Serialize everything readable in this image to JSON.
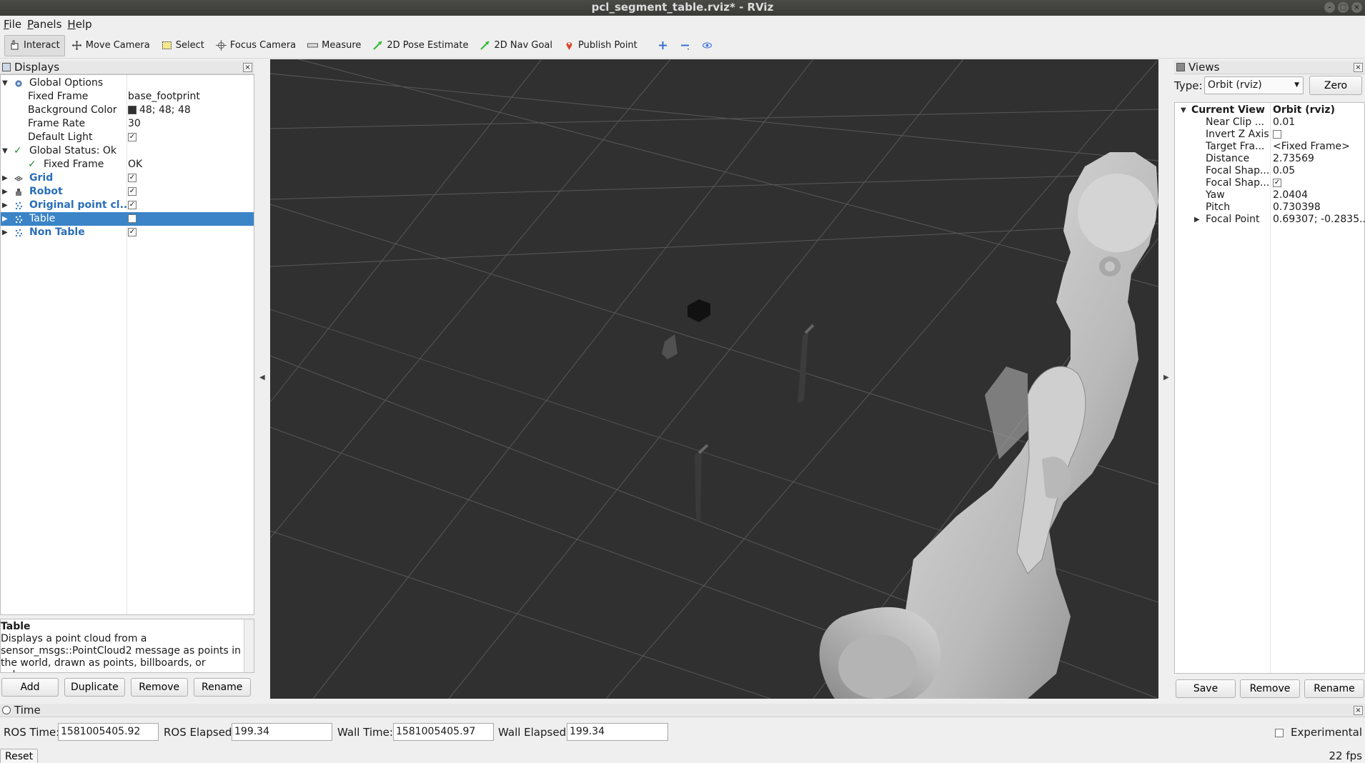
{
  "window": {
    "title": "pcl_segment_table.rviz* - RViz"
  },
  "menu": [
    "File",
    "Panels",
    "Help"
  ],
  "toolbar": {
    "tools": [
      "Interact",
      "Move Camera",
      "Select",
      "Focus Camera",
      "Measure",
      "2D Pose Estimate",
      "2D Nav Goal",
      "Publish Point"
    ]
  },
  "displays": {
    "title": "Displays",
    "global_options": "Global Options",
    "fixed_frame_label": "Fixed Frame",
    "fixed_frame_value": "base_footprint",
    "bg_color_label": "Background Color",
    "bg_color_value": "48; 48; 48",
    "frame_rate_label": "Frame Rate",
    "frame_rate_value": "30",
    "default_light_label": "Default Light",
    "global_status": "Global Status: Ok",
    "status_fixed_frame_label": "Fixed Frame",
    "status_fixed_frame_value": "OK",
    "grid": "Grid",
    "robot": "Robot",
    "original_cloud": "Original point cl...",
    "table": "Table",
    "non_table": "Non Table",
    "description_title": "Table",
    "description_text": "Displays a point cloud from a sensor_msgs::PointCloud2 message as points in the world, drawn as points, billboards, or cubes.",
    "buttons": {
      "add": "Add",
      "duplicate": "Duplicate",
      "remove": "Remove",
      "rename": "Rename"
    }
  },
  "views": {
    "title": "Views",
    "type_label": "Type:",
    "type_value": "Orbit (rviz)",
    "zero_button": "Zero",
    "current_view_label": "Current View",
    "current_view_value": "Orbit (rviz)",
    "props": [
      {
        "name": "Near Clip ...",
        "value": "0.01"
      },
      {
        "name": "Invert Z Axis",
        "value": ""
      },
      {
        "name": "Target Fra...",
        "value": "<Fixed Frame>"
      },
      {
        "name": "Distance",
        "value": "2.73569"
      },
      {
        "name": "Focal Shap...",
        "value": "0.05"
      },
      {
        "name": "Focal Shap...",
        "value": ""
      },
      {
        "name": "Yaw",
        "value": "2.0404"
      },
      {
        "name": "Pitch",
        "value": "0.730398"
      },
      {
        "name": "Focal Point",
        "value": "0.69307; -0.2835..."
      }
    ],
    "buttons": {
      "save": "Save",
      "remove": "Remove",
      "rename": "Rename"
    }
  },
  "time": {
    "title": "Time",
    "ros_time_label": "ROS Time:",
    "ros_time": "1581005405.92",
    "ros_elapsed_label": "ROS Elapsed:",
    "ros_elapsed": "199.34",
    "wall_time_label": "Wall Time:",
    "wall_time": "1581005405.97",
    "wall_elapsed_label": "Wall Elapsed:",
    "wall_elapsed": "199.34",
    "experimental_label": "Experimental",
    "reset_button": "Reset",
    "fps": "22 fps"
  },
  "colors": {
    "background": "#303030",
    "selection": "#3a84c7",
    "blue_display": "#2a6fb8",
    "ok_green": "#2a8a2a"
  }
}
